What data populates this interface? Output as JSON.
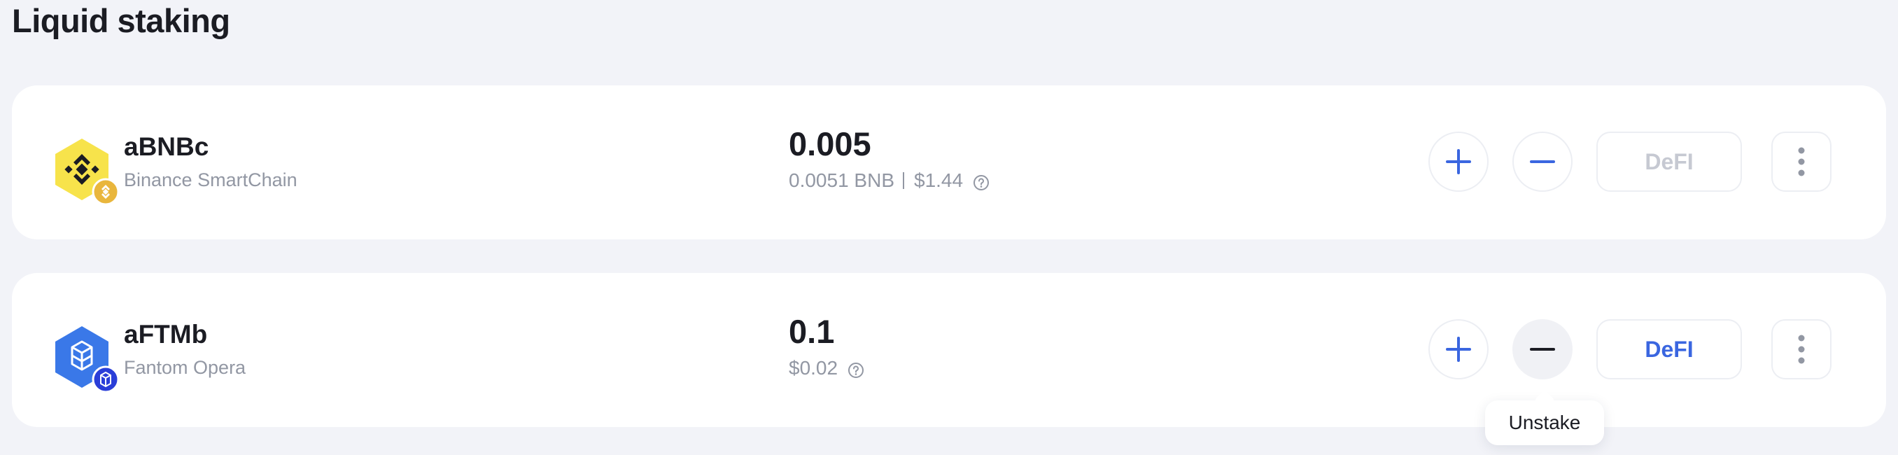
{
  "page": {
    "title": "Liquid staking"
  },
  "tokens": [
    {
      "name": "aBNBc",
      "network": "Binance SmartChain",
      "amount": "0.005",
      "native_amount": "0.0051 BNB",
      "usd_value": "$1.44",
      "icon": "bnb-token-icon",
      "network_icon": "bnb-network-badge-icon",
      "icon_color": "#f7e34b",
      "badge_color": "#e9b63c",
      "actions": {
        "stake_icon": "plus-icon",
        "unstake_icon": "minus-icon",
        "defi_label": "DeFI",
        "defi_disabled": true,
        "more_icon": "more-vertical-icon"
      }
    },
    {
      "name": "aFTMb",
      "network": "Fantom Opera",
      "amount": "0.1",
      "usd_value": "$0.02",
      "icon": "fantom-token-icon",
      "network_icon": "fantom-network-badge-icon",
      "icon_color": "#3a78e8",
      "badge_color": "#2a3ed8",
      "actions": {
        "stake_icon": "plus-icon",
        "unstake_icon": "minus-icon",
        "defi_label": "DeFI",
        "defi_disabled": false,
        "more_icon": "more-vertical-icon"
      }
    }
  ],
  "tooltip": {
    "text": "Unstake"
  },
  "colors": {
    "accent": "#3a66e0",
    "background": "#f2f3f8",
    "muted_text": "#9297a3"
  }
}
